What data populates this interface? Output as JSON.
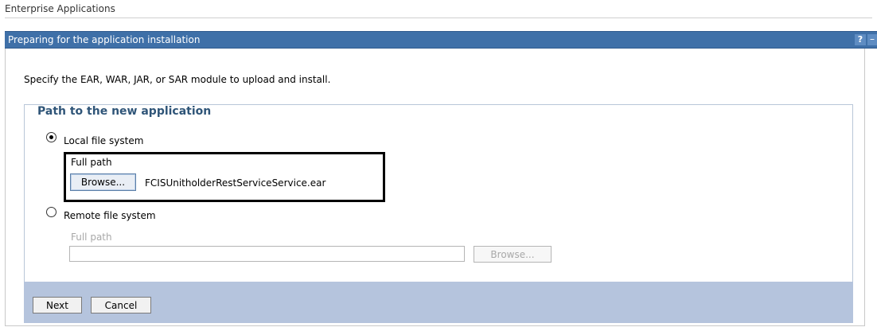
{
  "breadcrumb": "Enterprise Applications",
  "panel": {
    "title": "Preparing for the application installation",
    "help_icon": "?",
    "minimize_icon": "–"
  },
  "intro": "Specify the EAR, WAR, JAR, or SAR module to upload and install.",
  "path_section": {
    "legend": "Path to the new application",
    "local": {
      "label": "Local file system",
      "selected": true,
      "full_path_label": "Full path",
      "browse_label": "Browse...",
      "file_name": "FCISUnitholderRestServiceService.ear"
    },
    "remote": {
      "label": "Remote file system",
      "selected": false,
      "full_path_label": "Full path",
      "value": "",
      "browse_label": "Browse..."
    }
  },
  "actions": {
    "next_label": "Next",
    "cancel_label": "Cancel"
  }
}
